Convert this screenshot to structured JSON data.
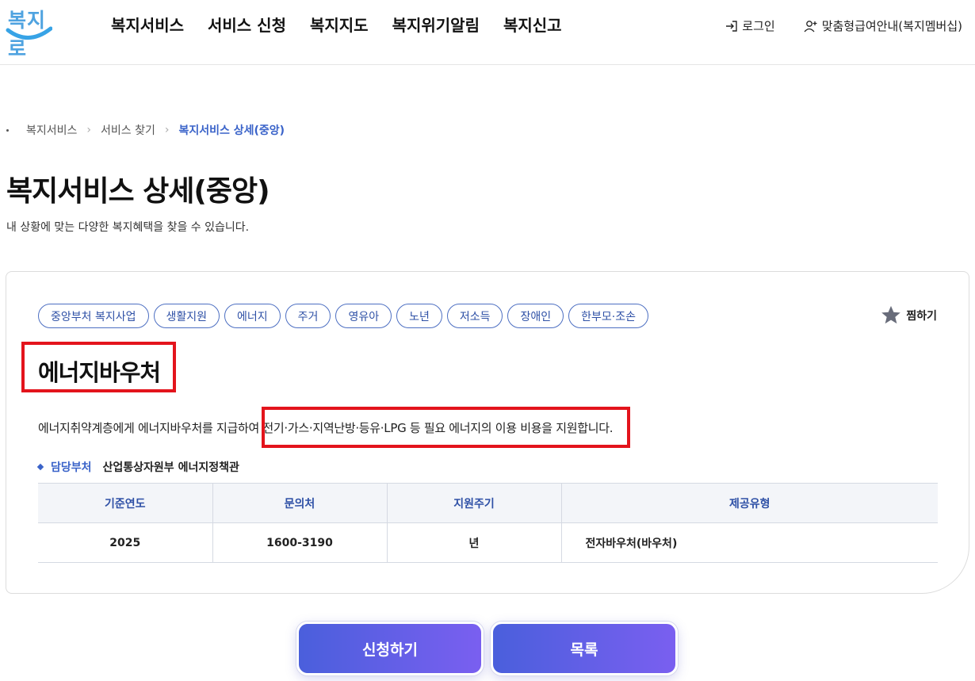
{
  "header": {
    "logo_text": "복지로",
    "nav": [
      "복지서비스",
      "서비스 신청",
      "복지지도",
      "복지위기알림",
      "복지신고"
    ],
    "login_label": "로그인",
    "membership_label": "맞춤형급여안내(복지멤버십)"
  },
  "breadcrumb": [
    "복지서비스",
    "서비스 찾기",
    "복지서비스 상세(중앙)"
  ],
  "page": {
    "title": "복지서비스 상세(중앙)",
    "description": "내 상황에 맞는 다양한 복지혜택을 찾을 수 있습니다."
  },
  "service": {
    "tags": [
      "중앙부처 복지사업",
      "생활지원",
      "에너지",
      "주거",
      "영유아",
      "노년",
      "저소득",
      "장애인",
      "한부모·조손"
    ],
    "favorite_label": "찜하기",
    "title": "에너지바우처",
    "description": "에너지취약계층에게 에너지바우처를 지급하여 전기·가스·지역난방·등유·LPG 등 필요 에너지의 이용 비용을 지원합니다.",
    "department_label": "담당부처",
    "department_value": "산업통상자원부 에너지정책관",
    "table": {
      "headers": [
        "기준연도",
        "문의처",
        "지원주기",
        "제공유형"
      ],
      "row": [
        "2025",
        "1600-3190",
        "년",
        "전자바우처(바우처)"
      ]
    }
  },
  "buttons": {
    "apply": "신청하기",
    "list": "목록"
  },
  "colors": {
    "accent": "#3a63c9",
    "highlight": "#e3141c",
    "button_start": "#4a5fdc",
    "button_end": "#7a5ff0"
  }
}
